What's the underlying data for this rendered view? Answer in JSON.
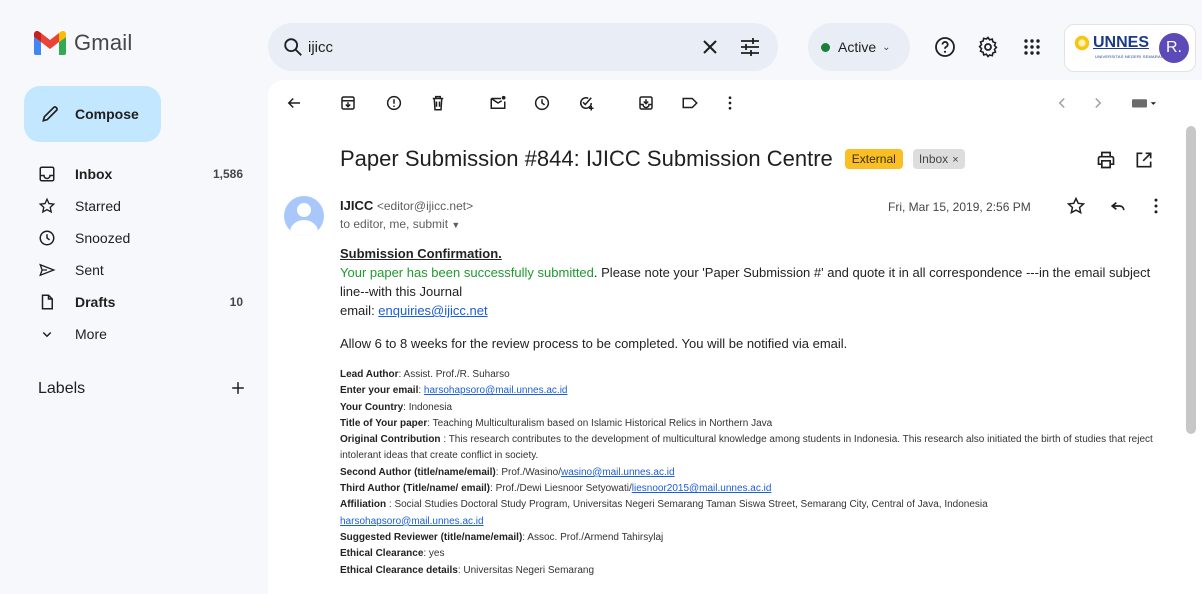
{
  "app": {
    "name": "Gmail"
  },
  "search": {
    "value": "ijicc"
  },
  "status": {
    "label": "Active"
  },
  "org": {
    "name": "UNNES",
    "subtitle": "UNIVERSITAS NEGERI SEMARANG"
  },
  "user": {
    "initial": "R."
  },
  "compose": {
    "label": "Compose"
  },
  "nav": {
    "items": [
      {
        "label": "Inbox",
        "count": "1,586"
      },
      {
        "label": "Starred",
        "count": ""
      },
      {
        "label": "Snoozed",
        "count": ""
      },
      {
        "label": "Sent",
        "count": ""
      },
      {
        "label": "Drafts",
        "count": "10"
      },
      {
        "label": "More",
        "count": ""
      }
    ]
  },
  "labels": {
    "title": "Labels"
  },
  "email": {
    "subject": "Paper Submission #844: IJICC Submission Centre",
    "badge_external": "External",
    "badge_inbox": "Inbox",
    "sender_name": "IJICC",
    "sender_email": "<editor@ijicc.net>",
    "to_line": "to editor, me, submit",
    "date": "Fri, Mar 15, 2019, 2:56 PM",
    "heading": "Submission Confirmation.",
    "success_text": "Your paper has been successfully submitted",
    "note_text": ". Please note your 'Paper Submission #' and quote it in all correspondence ---in the email subject line--with this Journal",
    "email_label": "email: ",
    "email_link": "enquiries@ijicc.net",
    "review_text": "Allow 6 to 8 weeks for the review process to be completed. You will be notified via email.",
    "fields": {
      "lead_author_label": "Lead Author",
      "lead_author_value": ": Assist. Prof./R. Suharso",
      "your_email_label": "Enter your email",
      "your_email_value": "harsohapsoro@mail.unnes.ac.id",
      "country_label": "Your Country",
      "country_value": ": Indonesia",
      "title_label": "Title of Your paper",
      "title_value": ": Teaching Multiculturalism based on Islamic Historical Relics in Northern Java",
      "contribution_label": "Original Contribution",
      "contribution_value": " : This research contributes to the development of multicultural knowledge among students in Indonesia. This research also initiated the birth of studies that reject intolerant ideas that create conflict in society.",
      "second_author_label": "Second Author (title/name/email)",
      "second_author_value": ": Prof./Wasino/",
      "second_author_link": "wasino@mail.unnes.ac.id",
      "third_author_label": "Third Author (Title/name/ email)",
      "third_author_value": ": Prof./Dewi Liesnoor Setyowati/",
      "third_author_link": "liesnoor2015@mail.unnes.ac.id",
      "affiliation_label": "Affiliation",
      "affiliation_value": " : Social Studies Doctoral Study Program, Universitas Negeri Semarang Taman Siswa Street, Semarang City, Central of Java, Indonesia",
      "affiliation_link": "harsohapsoro@mail.unnes.ac.id",
      "reviewer_label": "Suggested Reviewer (title/name/email)",
      "reviewer_value": ": Assoc. Prof./Armend Tahirsylaj",
      "ethical_label": "Ethical Clearance",
      "ethical_value": ": yes",
      "ethical_details_label": "Ethical Clearance details",
      "ethical_details_value": ": Universitas Negeri Semarang"
    }
  }
}
